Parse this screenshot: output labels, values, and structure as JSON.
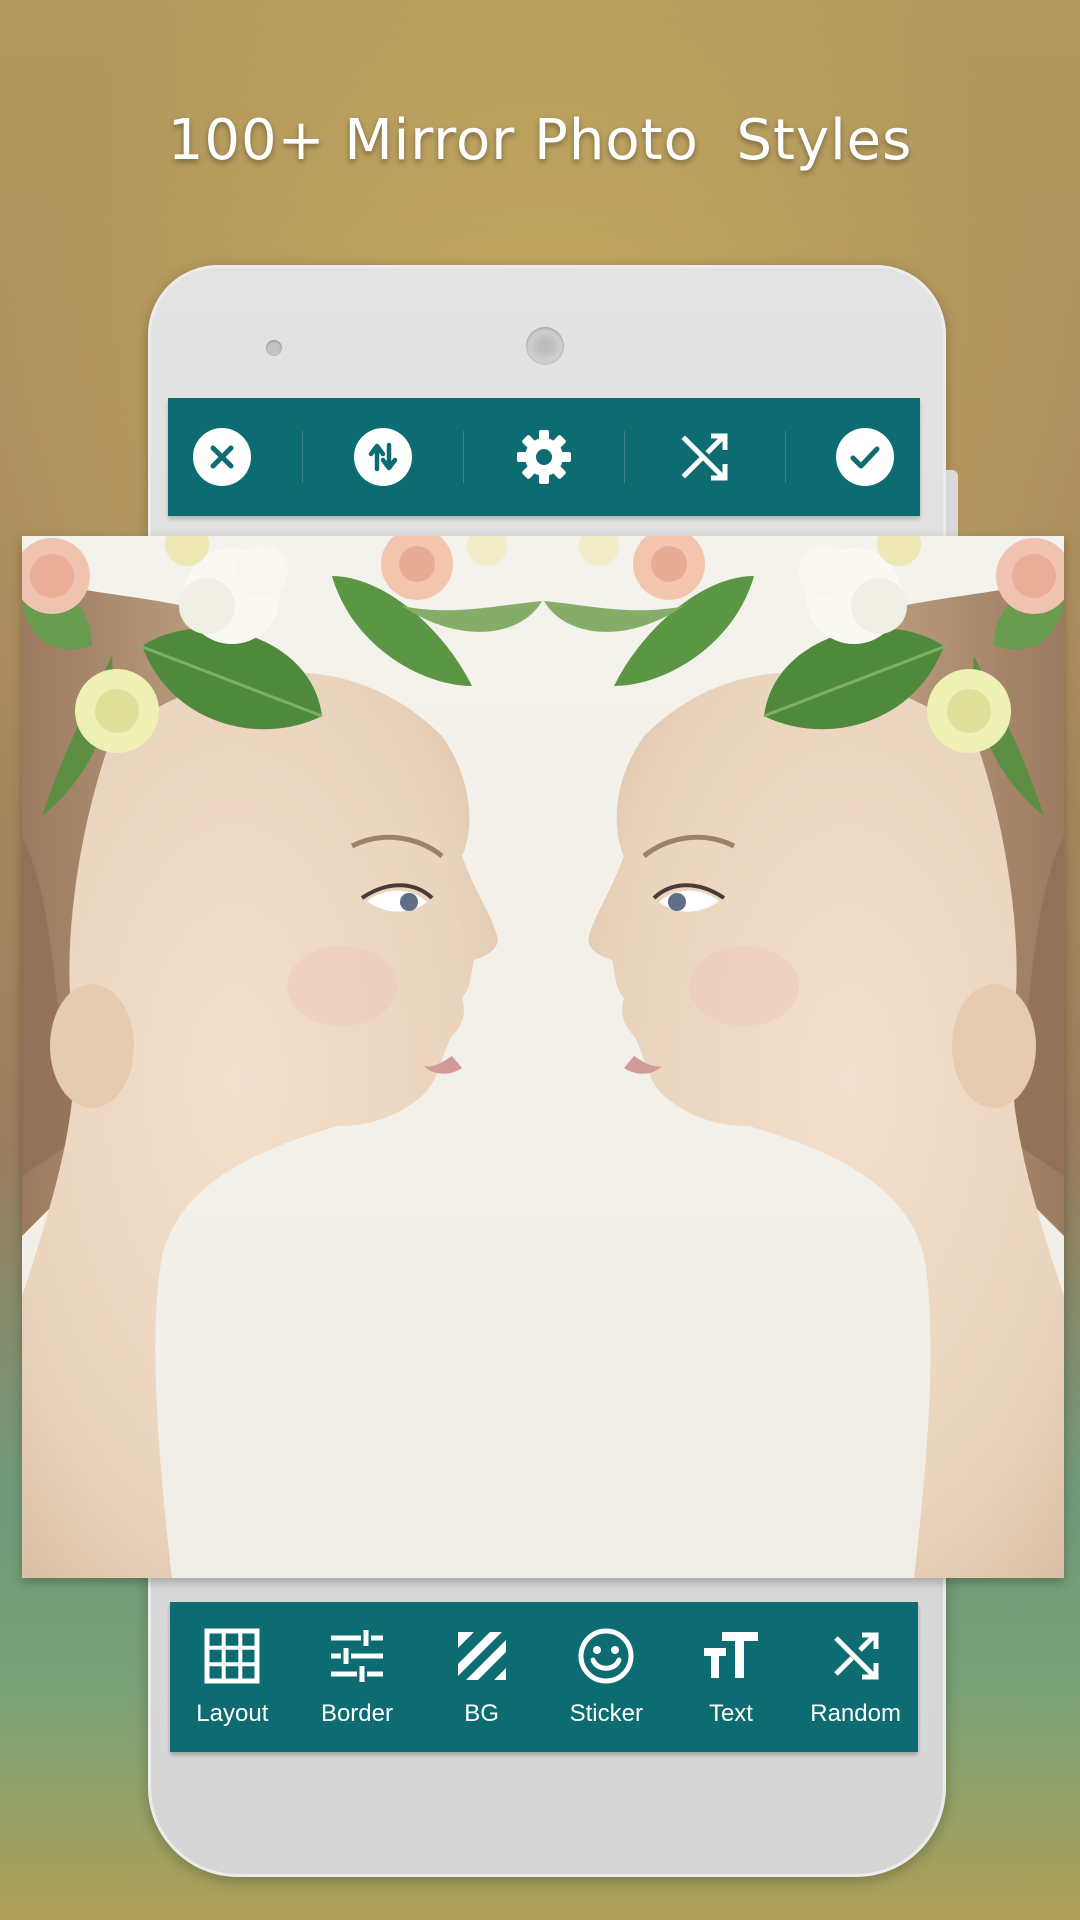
{
  "headline": "100+ Mirror Photo  Styles",
  "colors": {
    "toolbar": "#0d6b72",
    "icon_white": "#ffffff",
    "phone_body": "#d6d6d6"
  },
  "top_toolbar": [
    {
      "icon": "close-icon"
    },
    {
      "icon": "swap-vertical-icon"
    },
    {
      "icon": "gear-icon"
    },
    {
      "icon": "shuffle-icon"
    },
    {
      "icon": "check-icon"
    }
  ],
  "bottom_toolbar": {
    "layout": {
      "label": "Layout",
      "icon": "grid-icon"
    },
    "border": {
      "label": "Border",
      "icon": "sliders-icon"
    },
    "bg": {
      "label": "BG",
      "icon": "stripes-icon"
    },
    "sticker": {
      "label": "Sticker",
      "icon": "smiley-icon"
    },
    "text": {
      "label": "Text",
      "icon": "text-size-icon"
    },
    "random": {
      "label": "Random",
      "icon": "shuffle-icon"
    }
  }
}
